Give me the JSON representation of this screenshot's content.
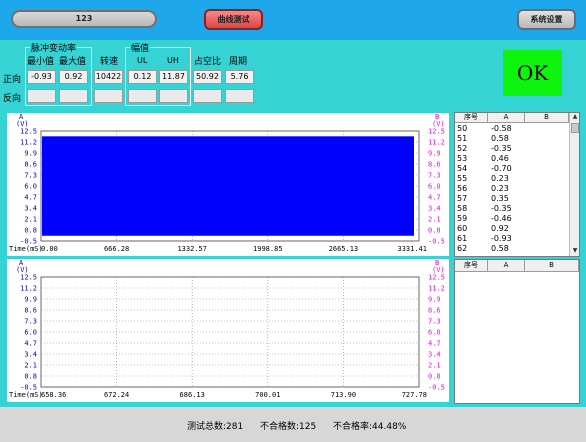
{
  "header": {
    "title": "123",
    "curve_test_button": "曲线测试",
    "settings_button": "系统设置"
  },
  "params": {
    "pulse_rate_group": "脉冲变动率",
    "min_label": "最小值",
    "max_label": "最大值",
    "speed_label": "转速",
    "amplitude_group": "幅值",
    "ul_label": "UL",
    "uh_label": "UH",
    "duty_label": "占空比",
    "period_label": "周期",
    "forward_label": "正向",
    "reverse_label": "反向",
    "forward": {
      "min": "-0.93",
      "max": "0.92",
      "speed": "10422",
      "ul": "0.12",
      "uh": "11.87",
      "duty": "50.92",
      "period": "5.76"
    },
    "reverse": {
      "min": "",
      "max": "",
      "speed": "",
      "ul": "",
      "uh": "",
      "duty": "",
      "period": ""
    }
  },
  "status": {
    "ok": "OK"
  },
  "chart_data": [
    {
      "type": "area",
      "left_axis_label": "A",
      "left_axis_unit": "(V)",
      "right_axis_label": "B",
      "right_axis_unit": "(V)",
      "y_ticks": [
        "12.5",
        "11.2",
        "9.9",
        "8.6",
        "7.3",
        "6.0",
        "4.7",
        "3.4",
        "2.1",
        "0.8",
        "-0.5"
      ],
      "ylim": [
        -0.5,
        12.5
      ],
      "x_label": "Time(mS)",
      "x_ticks": [
        "0.00",
        "666.28",
        "1332.57",
        "1998.85",
        "2665.13",
        "3331.41"
      ],
      "xlim": [
        0,
        3331.41
      ],
      "series": [
        {
          "x": [
            0,
            3331.41
          ],
          "low": [
            0.12,
            0.12
          ],
          "high": [
            11.87,
            11.87
          ],
          "color": "#0000ff"
        }
      ],
      "grid": true
    },
    {
      "type": "line",
      "left_axis_label": "A",
      "left_axis_unit": "(V)",
      "right_axis_label": "B",
      "right_axis_unit": "(V)",
      "y_ticks": [
        "12.5",
        "11.2",
        "9.9",
        "8.6",
        "7.3",
        "6.0",
        "4.7",
        "3.4",
        "2.1",
        "0.8",
        "-0.5"
      ],
      "ylim": [
        -0.5,
        12.5
      ],
      "x_label": "Time(mS)",
      "x_ticks": [
        "658.36",
        "672.24",
        "686.13",
        "700.01",
        "713.90",
        "727.78"
      ],
      "xlim": [
        658.36,
        727.78
      ],
      "series": [],
      "grid": true
    }
  ],
  "table1": {
    "headers": [
      "序号",
      "A",
      "B"
    ],
    "rows": [
      [
        "50",
        "-0.58",
        ""
      ],
      [
        "51",
        "0.58",
        ""
      ],
      [
        "52",
        "-0.35",
        ""
      ],
      [
        "53",
        "0.46",
        ""
      ],
      [
        "54",
        "-0.70",
        ""
      ],
      [
        "55",
        "0.23",
        ""
      ],
      [
        "56",
        "0.23",
        ""
      ],
      [
        "57",
        "0.35",
        ""
      ],
      [
        "58",
        "-0.35",
        ""
      ],
      [
        "59",
        "-0.46",
        ""
      ],
      [
        "60",
        "0.92",
        ""
      ],
      [
        "61",
        "-0.93",
        ""
      ],
      [
        "62",
        "0.58",
        ""
      ]
    ]
  },
  "table2": {
    "headers": [
      "序号",
      "A",
      "B"
    ],
    "rows": []
  },
  "footer": {
    "total_label": "测试总数:",
    "total_value": "281",
    "fail_label": "不合格数:",
    "fail_value": "125",
    "fail_rate_label": "不合格率:",
    "fail_rate_value": "44.48%"
  }
}
